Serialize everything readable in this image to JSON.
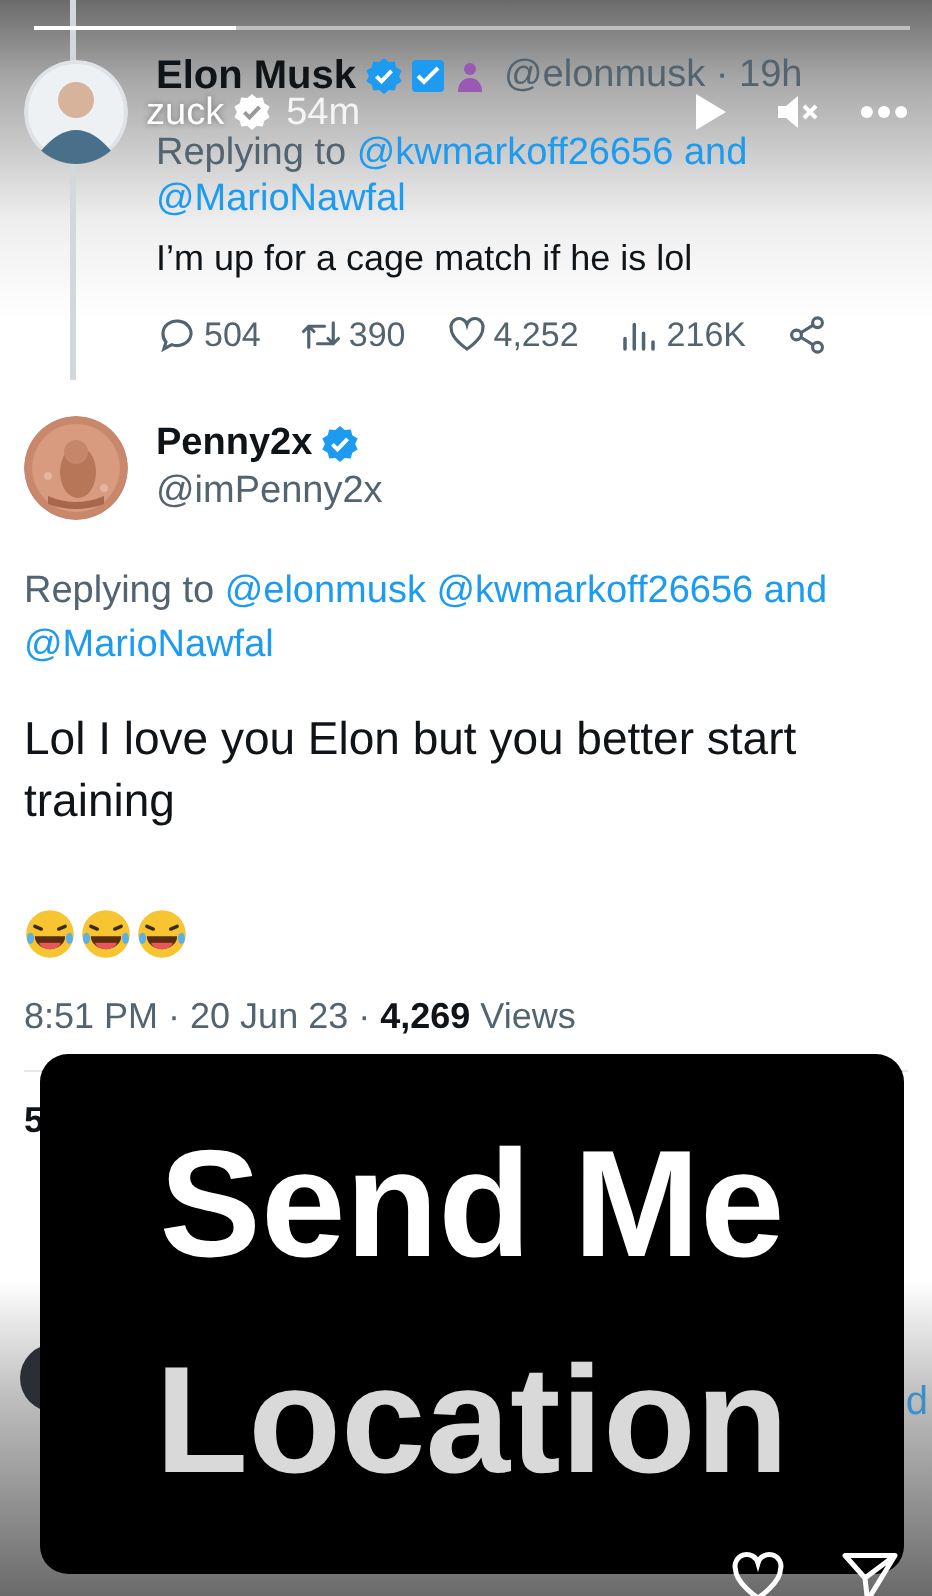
{
  "story": {
    "progress": {
      "level": 0.23
    },
    "user": "zuck",
    "verified": true,
    "time": "54m"
  },
  "tweet": {
    "name": "Elon Musk",
    "handle": "@elonmusk · 19h",
    "replying_prefix": "Replying to",
    "mentions": [
      "@kwmarkoff26656",
      "and",
      "@MarioNawfal"
    ],
    "text": "I’m up for a cage match if he is lol",
    "stats": [
      {
        "kind": "reply",
        "count": "504"
      },
      {
        "kind": "retweet",
        "count": "390"
      },
      {
        "kind": "like",
        "count": "4,252"
      },
      {
        "kind": "views",
        "count": "216K"
      },
      {
        "kind": "share"
      }
    ]
  },
  "reply": {
    "name": "Penny2x",
    "verified": true,
    "handle": "@imPenny2x",
    "replying_prefix": "Replying to",
    "mentions": [
      "@elonmusk",
      "@kwmarkoff26656",
      "and",
      "@MarioNawfal"
    ],
    "text": "Lol I love you Elon but you better start training",
    "emojis": [
      {
        "kind": "laugh"
      },
      {
        "kind": "laugh"
      },
      {
        "kind": "laugh"
      }
    ],
    "meta": "8:51 PM · 20 Jun 23 · **4,269** Views",
    "stats_fragment": "5",
    "next_fragment": "d"
  },
  "caption": {
    "lines": [
      "Send Me",
      "Location"
    ]
  }
}
